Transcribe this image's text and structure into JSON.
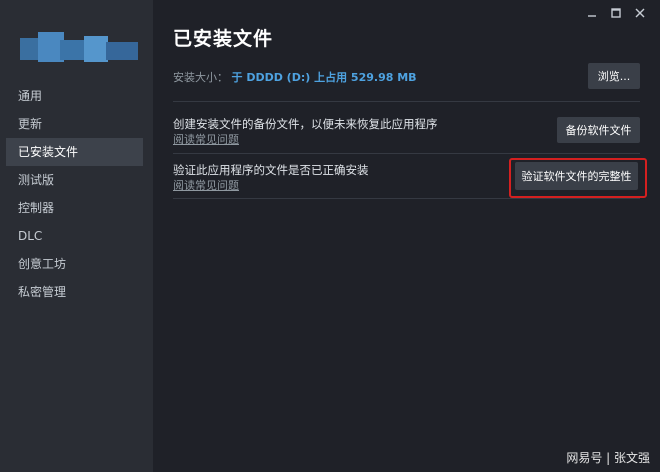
{
  "sidebar": {
    "items": [
      {
        "label": "通用"
      },
      {
        "label": "更新"
      },
      {
        "label": "已安装文件"
      },
      {
        "label": "测试版"
      },
      {
        "label": "控制器"
      },
      {
        "label": "DLC"
      },
      {
        "label": "创意工坊"
      },
      {
        "label": "私密管理"
      }
    ],
    "active_index": 2
  },
  "window_controls": {
    "minimize_icon": "minimize-icon",
    "maximize_icon": "maximize-icon",
    "close_icon": "close-icon"
  },
  "main": {
    "title": "已安装文件",
    "install_size": {
      "label": "安装大小：",
      "value": "于 DDDD (D:) 上占用 529.98 MB"
    },
    "browse_label": "浏览...",
    "backup": {
      "text": "创建安装文件的备份文件，以便未来恢复此应用程序",
      "link": "阅读常见问题",
      "button": "备份软件文件"
    },
    "verify": {
      "text": "验证此应用程序的文件是否已正确安装",
      "link": "阅读常见问题",
      "button": "验证软件文件的完整性"
    }
  },
  "watermark": "网易号 | 张文强",
  "colors": {
    "background": "#1f2128",
    "sidebar": "#2a2d34",
    "active_item": "#3d424b",
    "button": "#3a3f48",
    "accent_blue": "#4ea2e0",
    "highlight_red": "#d42020"
  }
}
